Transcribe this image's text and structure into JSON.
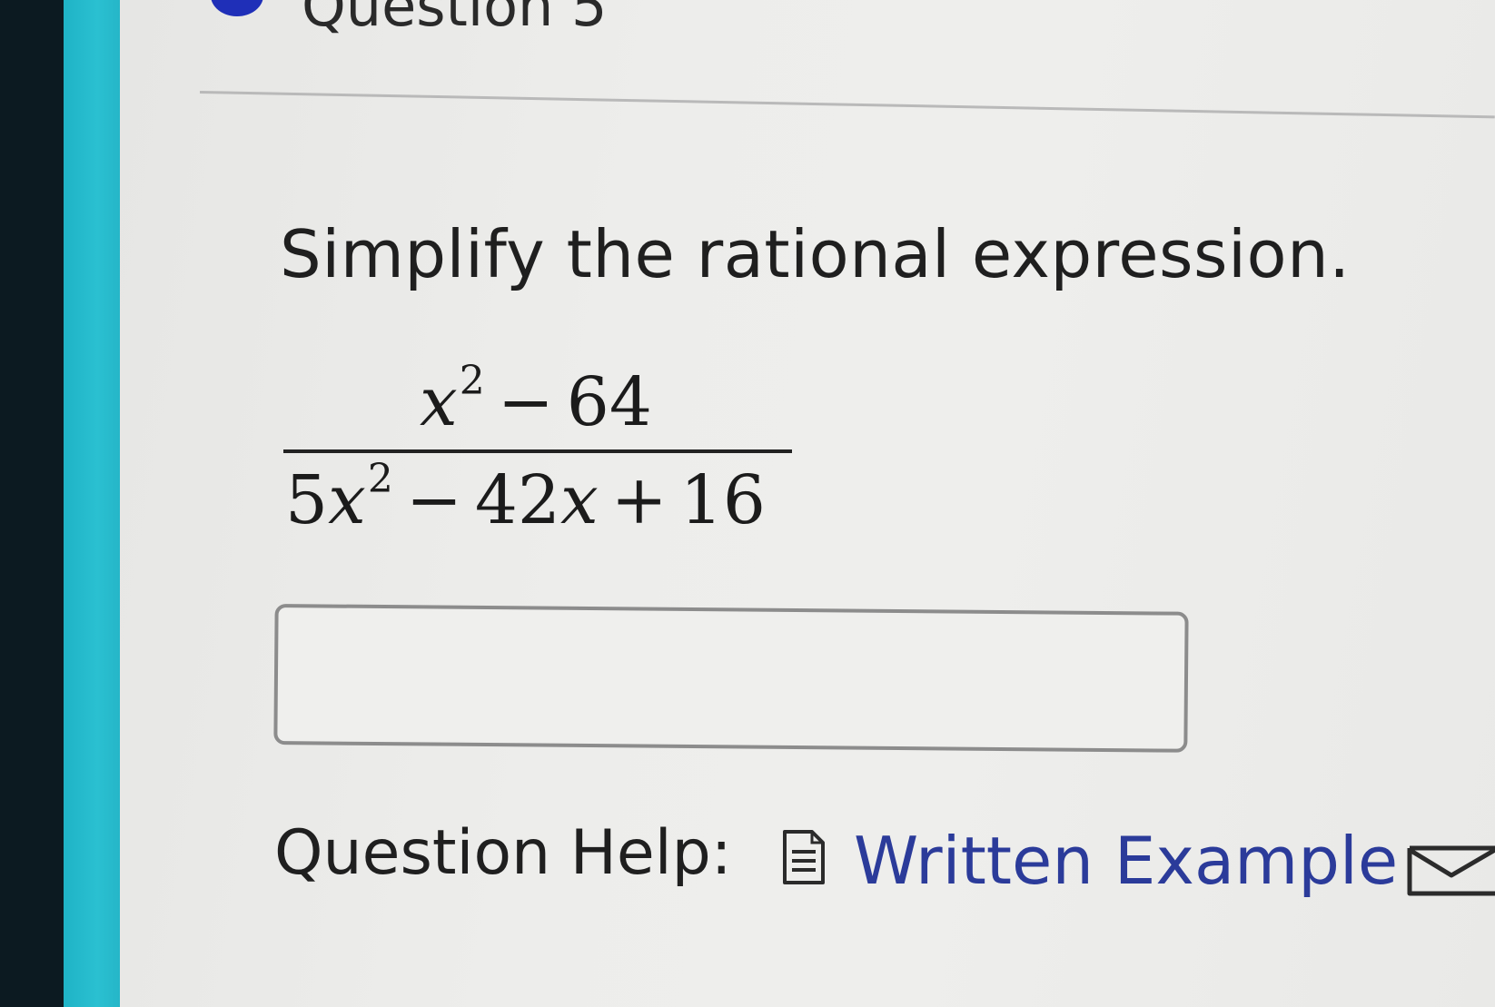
{
  "question": {
    "heading": "Question 5",
    "prompt": "Simplify the rational expression."
  },
  "expression": {
    "numerator": {
      "var": "x",
      "exp": "2",
      "op": "−",
      "const": "64"
    },
    "denominator": {
      "coef1": "5",
      "var1": "x",
      "exp1": "2",
      "op1": "−",
      "coef2": "42",
      "var2": "x",
      "op2": "+",
      "const": "16"
    }
  },
  "answer": {
    "value": ""
  },
  "help": {
    "label": "Question Help:",
    "written_example": "Written Example"
  },
  "colors": {
    "accent": "#25b6c8",
    "link": "#2b3b9a",
    "dot": "#1f2fb8"
  },
  "icons": {
    "written_example": "document-icon",
    "message": "mail-icon"
  }
}
